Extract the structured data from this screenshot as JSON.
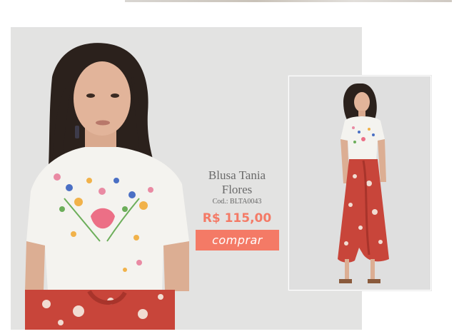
{
  "product": {
    "title_line1": "Blusa Tania",
    "title_line2": "Flores",
    "code": "Cod.: BLTA0043",
    "price": "R$ 115,00",
    "buy_label": "comprar"
  },
  "colors": {
    "accent": "#f47a66",
    "title_text": "#6a6a6a",
    "photo_background": "#e3e3e2",
    "skirt_red": "#c8453a"
  },
  "images": {
    "main_photo": "model-closeup-photo",
    "side_photo": "model-full-body-photo"
  }
}
